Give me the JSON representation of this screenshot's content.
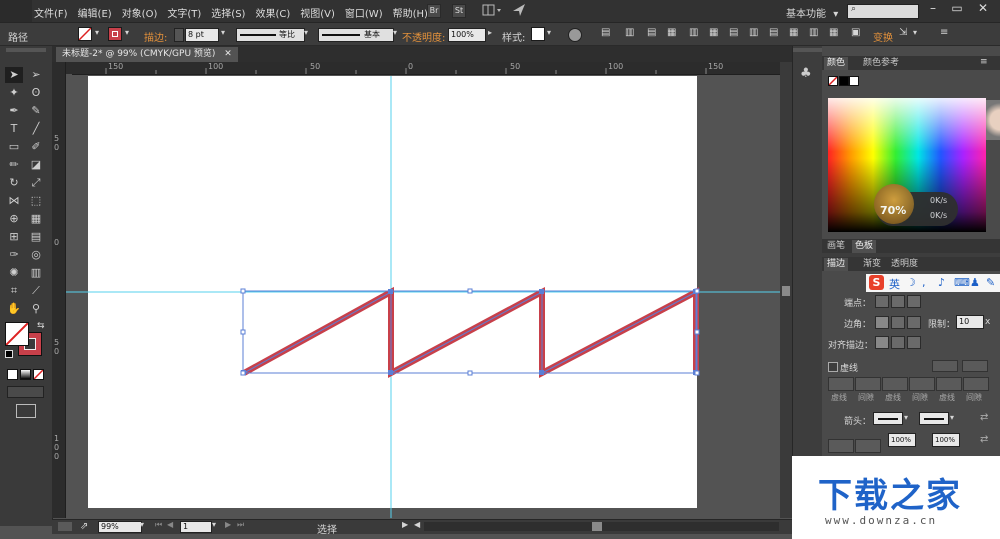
{
  "menubar": {
    "items": [
      "文件(F)",
      "编辑(E)",
      "对象(O)",
      "文字(T)",
      "选择(S)",
      "效果(C)",
      "视图(V)",
      "窗口(W)",
      "帮助(H)"
    ],
    "br": "Br",
    "st": "St",
    "workspace": "基本功能",
    "search_placeholder": ""
  },
  "controlbar": {
    "object_type": "路径",
    "stroke_label": "描边:",
    "stroke_weight": "8 pt",
    "profile_label": "等比",
    "brush_label": "基本",
    "opacity_label": "不透明度:",
    "opacity_value": "100%",
    "style_label": "样式:",
    "transform_label": "变换"
  },
  "document": {
    "tab_title": "未标题-2* @ 99% (CMYK/GPU 预览)",
    "zoom": "99%",
    "page": "1",
    "status_text": "选择"
  },
  "rulers": {
    "h_labels": [
      "150",
      "100",
      "50",
      "0",
      "50",
      "100",
      "150"
    ],
    "v_labels": [
      "5",
      "0",
      "0",
      "5",
      "0",
      "1",
      "0",
      "0"
    ]
  },
  "color_panel": {
    "tabs": [
      "颜色",
      "颜色参考"
    ],
    "widget_percent": "70%",
    "net_up": "0K/s",
    "net_down": "0K/s"
  },
  "swatch_tabs": [
    "画笔",
    "色板"
  ],
  "stroke_panel": {
    "tabs": [
      "描边",
      "渐变",
      "透明度"
    ],
    "ime_text": "英",
    "cap_label": "端点：",
    "corner_label": "边角：",
    "limit_label": "限制：",
    "limit_value": "10",
    "limit_unit": "x",
    "align_label": "对齐描边：",
    "dashed_label": "虚线",
    "dash_cols": [
      "虚线",
      "间隙",
      "虚线",
      "间隙",
      "虚线",
      "间隙"
    ],
    "arrows_label": "箭头：",
    "scale1": "100%",
    "scale2": "100%"
  },
  "colors": {
    "canvas_bg": "#535353",
    "zigzag": "#c8404a",
    "guide": "#56d2ee",
    "selection": "#5b7fd6"
  },
  "watermark": {
    "title": "下载之家",
    "url": "www.downza.cn"
  }
}
